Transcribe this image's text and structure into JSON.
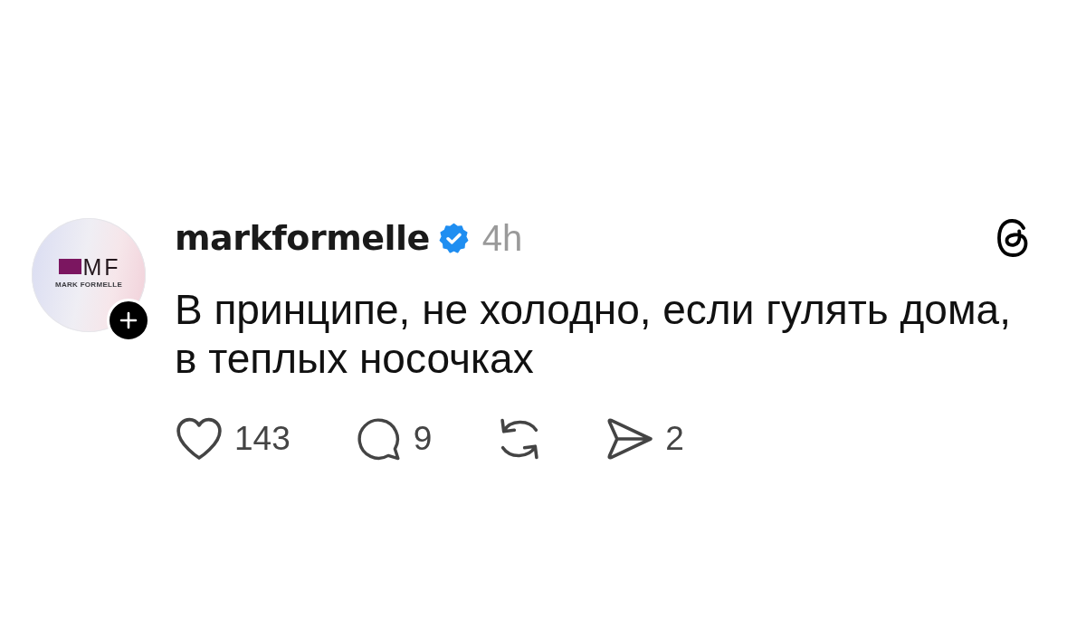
{
  "post": {
    "author": {
      "avatar": {
        "logo_text": "MF",
        "logo_caption": "MARK FORMELLE"
      },
      "username": "markformelle",
      "verified": true
    },
    "time": "4h",
    "text": "В принципе, не холодно, если гулять дома, в теплых носочках",
    "actions": [
      {
        "kind": "like",
        "count": "143"
      },
      {
        "kind": "reply",
        "count": "9"
      },
      {
        "kind": "repost"
      },
      {
        "kind": "share",
        "count": "2"
      }
    ]
  }
}
